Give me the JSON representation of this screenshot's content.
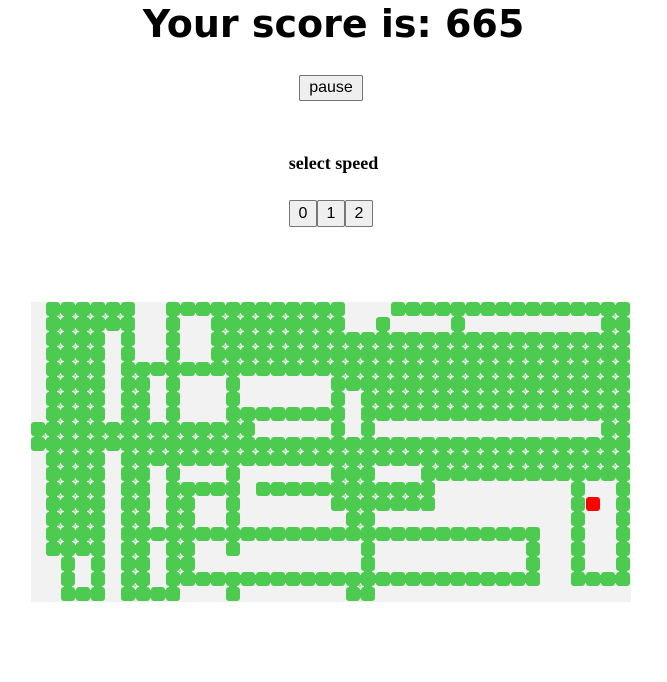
{
  "score_label": "Your score is: 665",
  "pause_label": "pause",
  "speed": {
    "label": "select speed",
    "options": [
      "0",
      "1",
      "2"
    ]
  },
  "colors": {
    "board_background": "#f2f2f2",
    "snake": "#4ccb50",
    "snake_inner": "#9be59d",
    "food": "#ff0000"
  },
  "game": {
    "grid_cols": 40,
    "grid_rows": 20,
    "food_cell": [
      37,
      13
    ],
    "snake_rows": [
      [
        1,
        2,
        3,
        4,
        5,
        6,
        9,
        10,
        11,
        12,
        13,
        14,
        15,
        16,
        17,
        18,
        19,
        20,
        24,
        25,
        26,
        27,
        28,
        29,
        30,
        31,
        32,
        33,
        34,
        35,
        36,
        37,
        38,
        39
      ],
      [
        1,
        2,
        3,
        4,
        5,
        6,
        9,
        12,
        13,
        14,
        15,
        16,
        17,
        18,
        19,
        20,
        23,
        28,
        38,
        39
      ],
      [
        1,
        2,
        3,
        4,
        6,
        9,
        12,
        13,
        14,
        15,
        16,
        17,
        18,
        19,
        20,
        21,
        22,
        23,
        24,
        25,
        26,
        27,
        28,
        29,
        30,
        31,
        32,
        33,
        34,
        35,
        36,
        37,
        38,
        39
      ],
      [
        1,
        2,
        3,
        4,
        6,
        9,
        12,
        13,
        14,
        15,
        16,
        17,
        18,
        19,
        20,
        21,
        22,
        23,
        24,
        25,
        26,
        27,
        28,
        29,
        30,
        31,
        32,
        33,
        34,
        35,
        36,
        37,
        38,
        39
      ],
      [
        1,
        2,
        3,
        4,
        6,
        7,
        8,
        9,
        10,
        11,
        12,
        13,
        14,
        15,
        16,
        17,
        18,
        19,
        20,
        21,
        22,
        23,
        24,
        25,
        26,
        27,
        28,
        29,
        30,
        31,
        32,
        33,
        34,
        35,
        36,
        37,
        38,
        39
      ],
      [
        1,
        2,
        3,
        4,
        6,
        7,
        9,
        13,
        20,
        21,
        22,
        23,
        24,
        25,
        26,
        27,
        28,
        29,
        30,
        31,
        32,
        33,
        34,
        35,
        36,
        37,
        38,
        39
      ],
      [
        1,
        2,
        3,
        4,
        6,
        7,
        9,
        13,
        20,
        22,
        23,
        24,
        25,
        26,
        27,
        28,
        29,
        30,
        31,
        32,
        33,
        34,
        35,
        36,
        37,
        38,
        39
      ],
      [
        1,
        2,
        3,
        4,
        6,
        7,
        9,
        13,
        14,
        15,
        16,
        17,
        18,
        19,
        20,
        22,
        23,
        24,
        25,
        26,
        27,
        28,
        29,
        30,
        31,
        32,
        33,
        34,
        35,
        36,
        37,
        38,
        39
      ],
      [
        0,
        1,
        2,
        3,
        4,
        5,
        6,
        7,
        8,
        9,
        10,
        11,
        12,
        13,
        14,
        20,
        22,
        38,
        39
      ],
      [
        0,
        1,
        2,
        3,
        4,
        5,
        6,
        7,
        8,
        9,
        10,
        11,
        12,
        13,
        14,
        15,
        16,
        17,
        18,
        19,
        20,
        21,
        22,
        23,
        24,
        25,
        26,
        27,
        28,
        29,
        30,
        31,
        32,
        33,
        34,
        35,
        36,
        37,
        38,
        39
      ],
      [
        1,
        2,
        3,
        4,
        6,
        7,
        8,
        9,
        10,
        11,
        12,
        13,
        14,
        15,
        16,
        17,
        18,
        19,
        20,
        21,
        22,
        23,
        24,
        25,
        26,
        27,
        28,
        29,
        30,
        31,
        32,
        33,
        34,
        35,
        36,
        37,
        38,
        39
      ],
      [
        1,
        2,
        3,
        4,
        6,
        7,
        9,
        13,
        20,
        21,
        22,
        26,
        27,
        28,
        29,
        30,
        31,
        32,
        33,
        34,
        35,
        36,
        37,
        38,
        39
      ],
      [
        1,
        2,
        3,
        4,
        6,
        7,
        9,
        10,
        11,
        12,
        13,
        15,
        16,
        17,
        18,
        19,
        20,
        21,
        22,
        23,
        24,
        25,
        26,
        36,
        39
      ],
      [
        1,
        2,
        3,
        4,
        6,
        7,
        9,
        10,
        13,
        20,
        21,
        22,
        23,
        24,
        25,
        26,
        36,
        39
      ],
      [
        1,
        2,
        3,
        4,
        6,
        7,
        9,
        10,
        13,
        21,
        22,
        36,
        39
      ],
      [
        1,
        2,
        3,
        4,
        6,
        7,
        8,
        9,
        10,
        11,
        12,
        13,
        14,
        15,
        16,
        17,
        18,
        19,
        20,
        21,
        22,
        23,
        24,
        25,
        26,
        27,
        28,
        29,
        30,
        31,
        32,
        33,
        36,
        39
      ],
      [
        1,
        2,
        3,
        4,
        6,
        7,
        9,
        10,
        13,
        22,
        33,
        36,
        39
      ],
      [
        2,
        4,
        6,
        7,
        9,
        10,
        22,
        33,
        36,
        39
      ],
      [
        2,
        4,
        6,
        7,
        9,
        10,
        11,
        12,
        13,
        14,
        15,
        16,
        17,
        18,
        19,
        20,
        21,
        22,
        23,
        24,
        25,
        26,
        27,
        28,
        29,
        30,
        31,
        32,
        33,
        36,
        37,
        38,
        39
      ],
      [
        2,
        3,
        4,
        6,
        7,
        8,
        9,
        13,
        21,
        22
      ]
    ]
  }
}
